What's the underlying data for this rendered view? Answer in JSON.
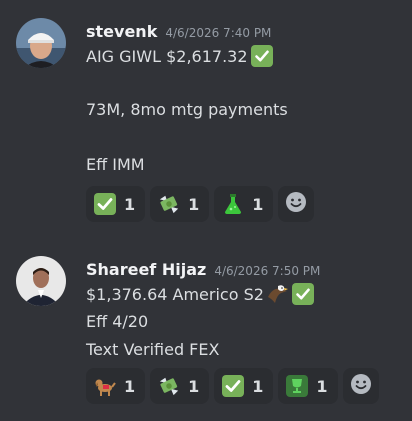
{
  "messages": [
    {
      "author": "stevenk",
      "timestamp": "4/6/2026 7:40 PM",
      "lines": [
        "AIG GIWL $2,617.32",
        "73M, 8mo mtg payments",
        "Eff IMM"
      ],
      "reactions": [
        {
          "icon": "white-check-mark-icon",
          "count": "1"
        },
        {
          "icon": "money-with-wings-icon",
          "count": "1"
        },
        {
          "icon": "flask-icon",
          "count": "1"
        }
      ]
    },
    {
      "author": "Shareef Hijaz",
      "timestamp": "4/6/2026 7:50 PM",
      "lines": [
        "$1,376.64 Americo S2",
        "Eff 4/20",
        "Text Verified FEX"
      ],
      "reactions": [
        {
          "icon": "service-dog-icon",
          "count": "1"
        },
        {
          "icon": "money-with-wings-icon",
          "count": "1"
        },
        {
          "icon": "white-check-mark-icon",
          "count": "1"
        },
        {
          "icon": "trophy-icon",
          "count": "1"
        }
      ]
    }
  ],
  "colors": {
    "background": "#313338",
    "reaction_bg": "#2b2d31",
    "check_green": "#78b159",
    "timestamp": "#949ba4"
  }
}
